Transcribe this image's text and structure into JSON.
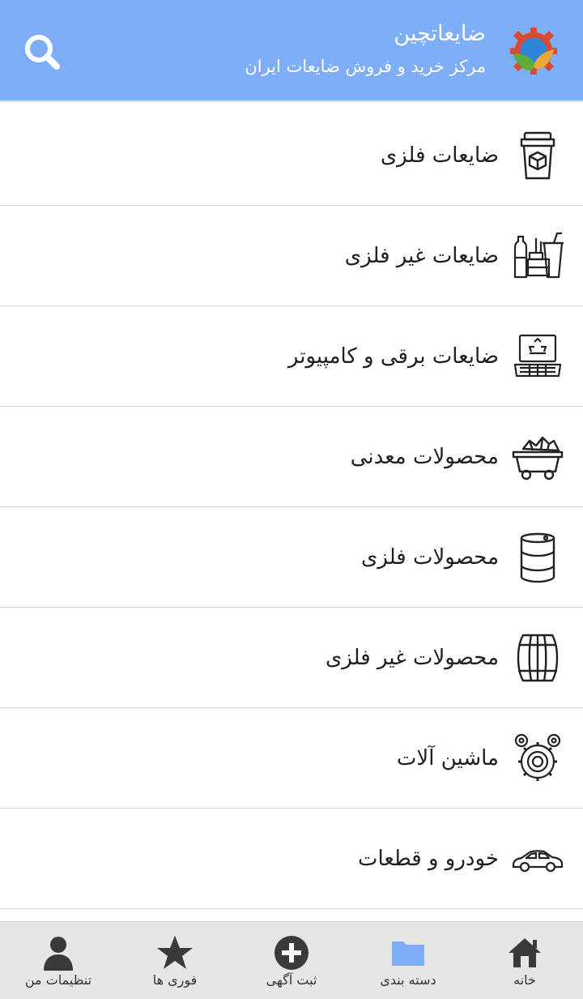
{
  "header": {
    "title": "ضایعاتچین",
    "subtitle": "مرکز خرید و فروش ضایعات ایران",
    "background_color": "#7eaef7",
    "logo_icon": "gear-leaf-logo",
    "search_icon": "search-icon"
  },
  "categories": [
    {
      "label": "ضایعات فلزی",
      "icon": "trash-bin-box-icon"
    },
    {
      "label": "ضایعات غیر فلزی",
      "icon": "bottles-cups-icon"
    },
    {
      "label": "ضایعات برقی و کامپیوتر",
      "icon": "laptop-recycle-icon"
    },
    {
      "label": "محصولات معدنی",
      "icon": "mine-cart-icon"
    },
    {
      "label": "محصولات فلزی",
      "icon": "oil-barrel-icon"
    },
    {
      "label": "محصولات غیر فلزی",
      "icon": "wooden-barrel-icon"
    },
    {
      "label": "ماشین آلات",
      "icon": "gears-icon"
    },
    {
      "label": "خودرو و قطعات",
      "icon": "car-icon"
    }
  ],
  "bottom_nav": [
    {
      "label": "خانه",
      "icon": "home-icon"
    },
    {
      "label": "دسته بندی",
      "icon": "folder-icon",
      "active": true,
      "active_color": "#7eaef7"
    },
    {
      "label": "ثبت آگهی",
      "icon": "add-circle-icon"
    },
    {
      "label": "فوری ها",
      "icon": "star-icon"
    },
    {
      "label": "تنظیمات من",
      "icon": "user-icon"
    }
  ]
}
